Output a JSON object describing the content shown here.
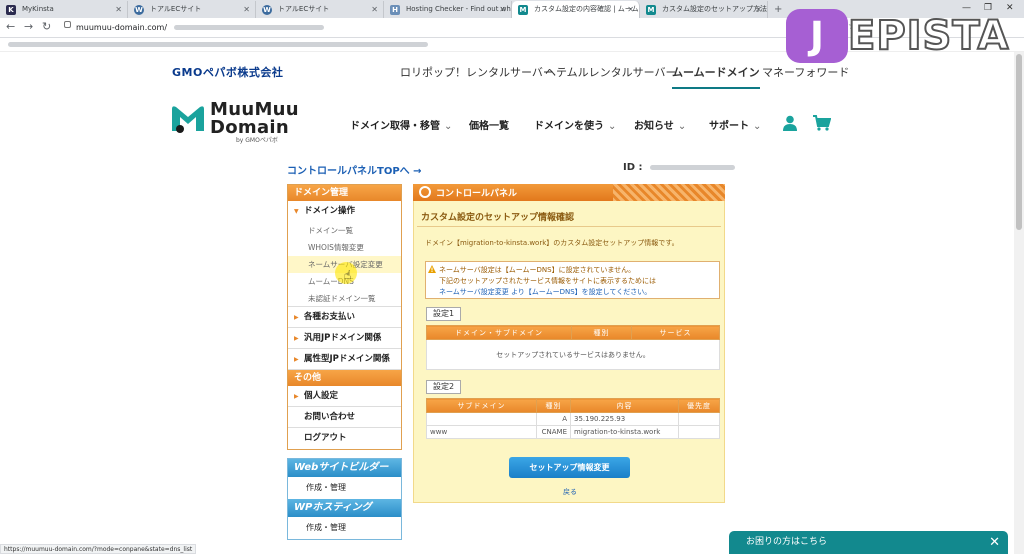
{
  "browser": {
    "tabs": [
      {
        "label": "MyKinsta",
        "icon": "kinsta-icon",
        "icon_color": "#2b2b4f",
        "icon_char": "K"
      },
      {
        "label": "トアルECサイト",
        "icon": "wordpress-icon",
        "icon_color": "#3c6b9e",
        "icon_char": "W"
      },
      {
        "label": "トアルECサイト",
        "icon": "wordpress-icon",
        "icon_color": "#3c6b9e",
        "icon_char": "W"
      },
      {
        "label": "Hosting Checker - Find out who",
        "icon": "hosting-checker-icon",
        "icon_color": "#6b8fb8",
        "icon_char": "H"
      },
      {
        "label": "カスタム設定の内容確認 | ムームー",
        "icon": "muumuu-icon",
        "icon_color": "#12898e",
        "icon_char": "M"
      },
      {
        "label": "カスタム設定のセットアップ方法 - ムー",
        "icon": "muumuu-icon",
        "icon_color": "#12898e",
        "icon_char": "M"
      }
    ],
    "url": "muumuu-domain.com/",
    "status_url": "https://muumuu-domain.com/?mode=conpane&state=dns_list"
  },
  "overlay_logo": {
    "first_letter": "J",
    "rest": "EPISTA"
  },
  "gmo": {
    "logo": "GMOペパボ株式会社",
    "nav": [
      "ロリポップ！レンタルサーバー",
      "ヘテムルレンタルサーバー",
      "ムームードメイン",
      "マネーフォワード"
    ]
  },
  "brand": {
    "line1": "MuuMuu",
    "line2": "Domain",
    "sub": "by GMOペパボ"
  },
  "main_nav": [
    "ドメイン取得・移管",
    "価格一覧",
    "ドメインを使う",
    "お知らせ",
    "サポート"
  ],
  "cp_link": "コントロールパネルTOPへ →",
  "id_label": "ID :",
  "sidebar": {
    "domain_head": "ドメイン管理",
    "domain_ops": "ドメイン操作",
    "domain_sub": [
      "ドメイン一覧",
      "WHOIS情報変更",
      "ネームサーバ設定変更",
      "ムームーDNS",
      "未認証ドメイン一覧"
    ],
    "cats": [
      "各種お支払い",
      "汎用JPドメイン関係",
      "属性型JPドメイン関係"
    ],
    "other_head": "その他",
    "other_items": [
      "個人設定",
      "お問い合わせ",
      "ログアウト"
    ],
    "web_builder_head": "Webサイトビルダー",
    "web_builder_item": "作成・管理",
    "wp_hosting_head": "WPホスティング",
    "wp_hosting_item": "作成・管理"
  },
  "panel": {
    "title": "コントロールパネル",
    "section_title": "カスタム設定のセットアップ情報確認",
    "desc": "ドメイン【migration-to-kinsta.work】のカスタム設定セットアップ情報です。",
    "warning": [
      "ネームサーバ設定は【ムームーDNS】に設定されていません。",
      "下記のセットアップされたサービス情報をサイトに表示するためには",
      "ネームサーバ設定変更 より【ムームーDNS】を設定してください。"
    ],
    "set1": {
      "label": "設定1",
      "headers": [
        "ドメイン・サブドメイン",
        "種別",
        "サービス"
      ],
      "empty": "セットアップされているサービスはありません。"
    },
    "set2": {
      "label": "設定2",
      "headers": [
        "サブドメイン",
        "種別",
        "内容",
        "優先度"
      ],
      "rows": [
        {
          "sub": "",
          "type": "A",
          "content": "35.190.225.93",
          "priority": ""
        },
        {
          "sub": "www",
          "type": "CNAME",
          "content": "migration-to-kinsta.work",
          "priority": ""
        }
      ]
    },
    "button": "セットアップ情報変更",
    "back": "戻る"
  },
  "help_bar": {
    "label": "お困りの方はこちら",
    "close": "✕"
  }
}
